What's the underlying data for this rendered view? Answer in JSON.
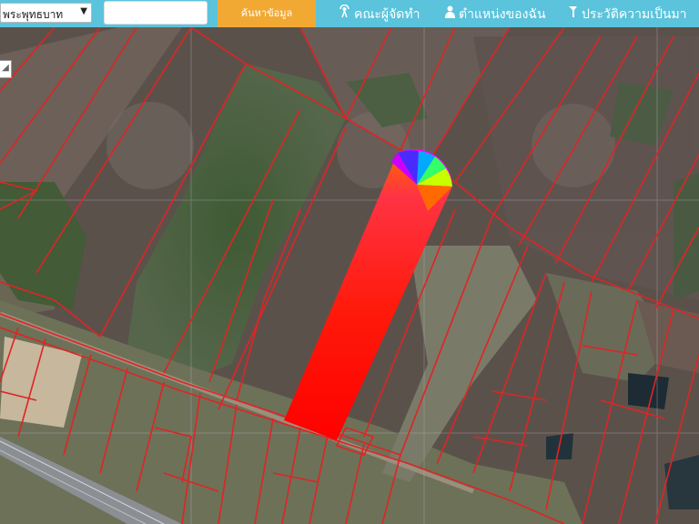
{
  "header": {
    "province_select": {
      "value": "พระพุทธบาท"
    },
    "search_input": {
      "value": "",
      "placeholder": ""
    },
    "search_button": "ค้นหาข้อมูล",
    "nav": [
      {
        "label": "คณะผู้จัดทำ",
        "icon": "antenna-icon"
      },
      {
        "label": "ตำแหน่งของฉัน",
        "icon": "person-icon"
      },
      {
        "label": "ประวัติความเป็นมา",
        "icon": "history-icon"
      }
    ]
  },
  "map": {
    "map_type": "satellite",
    "parcel_line_color": "#e02424",
    "highlight": {
      "shape": "direction-cone-gradient",
      "colors": [
        "#ff0000",
        "#ff8800",
        "#ffff00",
        "#00ff00",
        "#0000ff",
        "#ff00ff"
      ]
    }
  },
  "colors": {
    "topbar": "#5bc3dc",
    "search_button": "#f2a934"
  }
}
